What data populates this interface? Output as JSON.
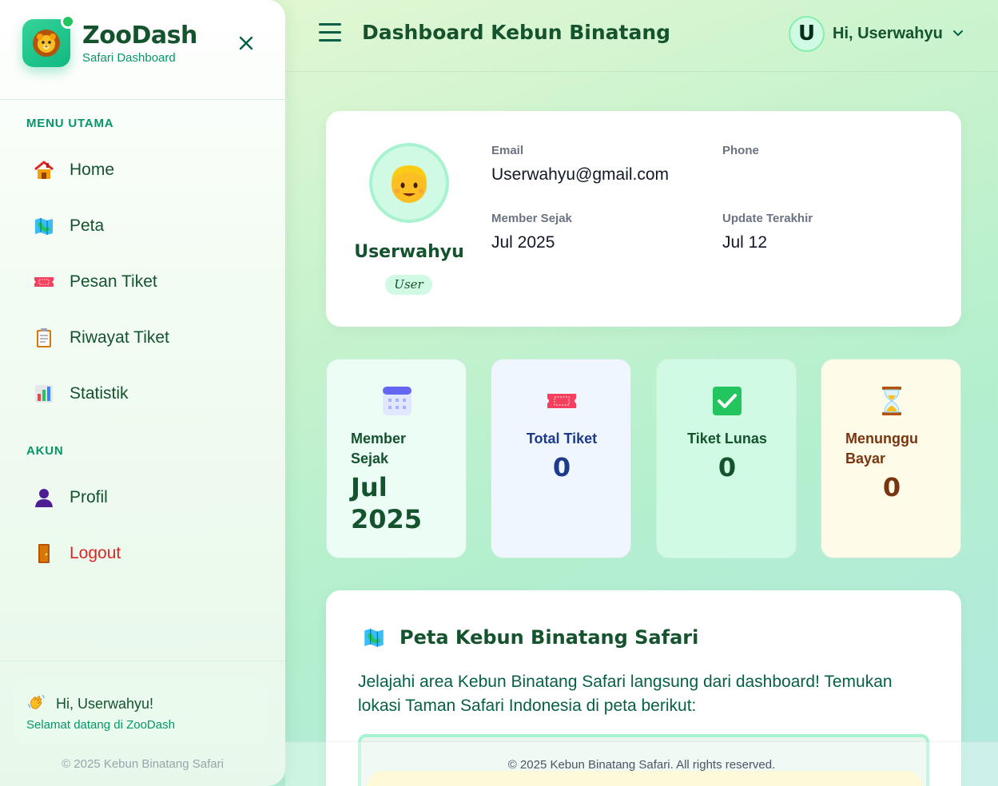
{
  "brand": {
    "title": "ZooDash",
    "subtitle": "Safari Dashboard",
    "logo_icon": "lion-face-icon"
  },
  "sidebar": {
    "section_main": "MENU UTAMA",
    "section_account": "AKUN",
    "main_items": [
      {
        "label": "Home",
        "icon": "house-icon"
      },
      {
        "label": "Peta",
        "icon": "map-icon"
      },
      {
        "label": "Pesan Tiket",
        "icon": "ticket-icon"
      },
      {
        "label": "Riwayat Tiket",
        "icon": "clipboard-icon"
      },
      {
        "label": "Statistik",
        "icon": "bar-chart-icon"
      }
    ],
    "account_items": [
      {
        "label": "Profil",
        "icon": "user-silhouette-icon"
      },
      {
        "label": "Logout",
        "icon": "door-icon"
      }
    ],
    "greeting": {
      "title": "Hi, Userwahyu!",
      "subtitle": "Selamat datang di ZooDash",
      "icon": "waving-hand-icon"
    },
    "footer": "© 2025 Kebun Binatang Safari"
  },
  "header": {
    "title": "Dashboard Kebun Binatang",
    "avatar_initial": "U",
    "user_greeting": "Hi, Userwahyu"
  },
  "profile": {
    "name": "Userwahyu",
    "role": "User",
    "fields": {
      "email_label": "Email",
      "email_value": "Userwahyu@gmail.com",
      "phone_label": "Phone",
      "phone_value": "",
      "member_label": "Member Sejak",
      "member_value": "Jul 2025",
      "updated_label": "Update Terakhir",
      "updated_value": "Jul 12"
    }
  },
  "stats": [
    {
      "label": "Member Sejak",
      "value": "Jul 2025",
      "icon": "calendar-icon",
      "bg": "#ecfdf5",
      "label_color": "#14532d",
      "value_color": "#14532d"
    },
    {
      "label": "Total Tiket",
      "value": "0",
      "icon": "ticket-icon",
      "bg": "#eff6ff",
      "label_color": "#1e3a8a",
      "value_color": "#1e3a8a"
    },
    {
      "label": "Tiket Lunas",
      "value": "0",
      "icon": "check-box-icon",
      "bg": "#d1fae5",
      "label_color": "#14532d",
      "value_color": "#14532d"
    },
    {
      "label": "Menunggu Bayar",
      "value": "0",
      "icon": "hourglass-icon",
      "bg": "#fefce8",
      "label_color": "#78350f",
      "value_color": "#78350f"
    }
  ],
  "map": {
    "title": "Peta Kebun Binatang Safari",
    "description": "Jelajahi area Kebun Binatang Safari langsung dari dashboard! Temukan lokasi Taman Safari Indonesia di peta berikut:",
    "icon": "map-icon"
  },
  "footer": {
    "text": "© 2025 Kebun Binatang Safari. All rights reserved."
  },
  "colors": {
    "accent": "#10b981",
    "primary_text": "#14532d",
    "logout": "#dc2626"
  }
}
